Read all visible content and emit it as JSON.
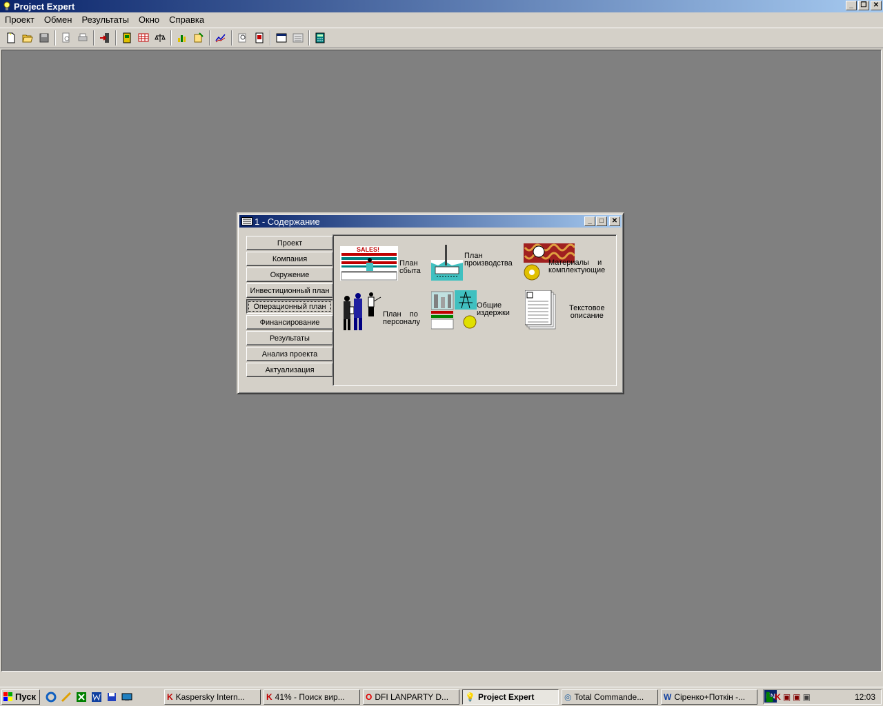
{
  "window": {
    "title": "Project Expert"
  },
  "menu": [
    "Проект",
    "Обмен",
    "Результаты",
    "Окно",
    "Справка"
  ],
  "child": {
    "title": "1 - Содержание",
    "nav": [
      "Проект",
      "Компания",
      "Окружение",
      "Инвестиционный план",
      "Операционный план",
      "Финансирование",
      "Результаты",
      "Анализ проекта",
      "Актуализация"
    ],
    "active_nav": "Операционный план",
    "items": {
      "sales": {
        "line1": "План",
        "line2": "сбыта",
        "badge": "SALES!"
      },
      "production": {
        "line1": "План",
        "line2": "производства"
      },
      "materials": {
        "line1": "Материалы    и",
        "line2": "комплектующие"
      },
      "personnel": {
        "line1": "План    по",
        "line2": "персоналу"
      },
      "costs": {
        "line1": "Общие",
        "line2": "издержки"
      },
      "text": {
        "line1": "Текстовое",
        "line2": "описание"
      }
    }
  },
  "taskbar": {
    "start": "Пуск",
    "tasks": [
      "Kaspersky Intern...",
      "41% - Поиск вир...",
      "DFI LANPARTY D...",
      "Project Expert",
      "Total Commande...",
      "Сіренко+Поткін -..."
    ],
    "active_task": "Project Expert",
    "lang": "EN",
    "clock": "12:03"
  }
}
